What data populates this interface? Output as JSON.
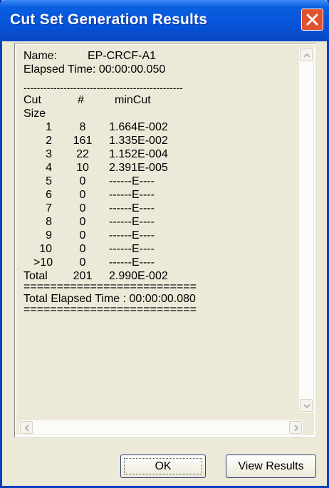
{
  "window": {
    "title": "Cut Set Generation Results",
    "close_icon": "close-icon"
  },
  "results": {
    "name_label": "Name:",
    "name_value": "EP-CRCF-A1",
    "elapsed_line": "Elapsed Time: 00:00:00.050",
    "separator_dash": "------------------------------------------------",
    "header": {
      "cut": "Cut",
      "num": "#",
      "mincut": "minCut",
      "size": "Size"
    },
    "rows": [
      {
        "size": "1",
        "count": "8",
        "mincut": "1.664E-002"
      },
      {
        "size": "2",
        "count": "161",
        "mincut": "1.335E-002"
      },
      {
        "size": "3",
        "count": "22",
        "mincut": "1.152E-004"
      },
      {
        "size": "4",
        "count": "10",
        "mincut": "2.391E-005"
      },
      {
        "size": "5",
        "count": "0",
        "mincut": "------E----"
      },
      {
        "size": "6",
        "count": "0",
        "mincut": "------E----"
      },
      {
        "size": "7",
        "count": "0",
        "mincut": "------E----"
      },
      {
        "size": "8",
        "count": "0",
        "mincut": "------E----"
      },
      {
        "size": "9",
        "count": "0",
        "mincut": "------E----"
      },
      {
        "size": "10",
        "count": "0",
        "mincut": "------E----"
      },
      {
        "size": ">10",
        "count": "0",
        "mincut": "------E----"
      }
    ],
    "total": {
      "label": "Total",
      "count": "201",
      "mincut": "2.990E-002"
    },
    "separator_eq": "==========================",
    "total_elapsed": "Total Elapsed Time : 00:00:00.080"
  },
  "buttons": {
    "ok": "OK",
    "view_results": "View Results"
  }
}
